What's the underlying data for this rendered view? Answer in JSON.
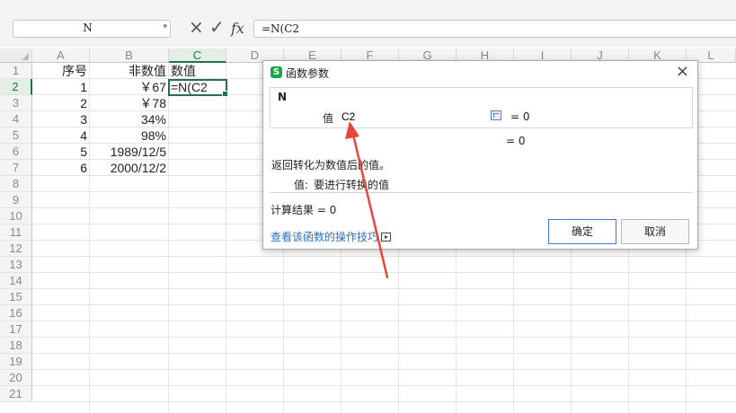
{
  "formula_bar": {
    "name_box_value": "N",
    "cancel_glyph": "×",
    "confirm_glyph": "✓",
    "fx_label": "fx",
    "formula": "=N(C2"
  },
  "grid": {
    "columns": [
      "A",
      "B",
      "C",
      "D",
      "E",
      "F",
      "G",
      "H",
      "I",
      "J",
      "K",
      "L"
    ],
    "selected_column": "C",
    "rows": [
      "1",
      "2",
      "3",
      "4",
      "5",
      "6",
      "7",
      "8",
      "9",
      "10",
      "11",
      "12",
      "13",
      "14",
      "15",
      "16",
      "17",
      "18",
      "19",
      "20",
      "21"
    ],
    "selected_row": "2",
    "headers": {
      "a": "序号",
      "b": "非数值",
      "c": "数值"
    },
    "data": [
      {
        "a": "1",
        "b": "￥67",
        "c": "=N(C2"
      },
      {
        "a": "2",
        "b": "￥78",
        "c": ""
      },
      {
        "a": "3",
        "b": "34%",
        "c": ""
      },
      {
        "a": "4",
        "b": "98%",
        "c": ""
      },
      {
        "a": "5",
        "b": "1989/12/5",
        "c": ""
      },
      {
        "a": "6",
        "b": "2000/12/2",
        "c": ""
      }
    ],
    "selection_color": "#217346"
  },
  "dialog": {
    "icon_glyph": "S",
    "title": "函数参数",
    "close_glyph": "×",
    "function_name": "N",
    "arg_label": "值",
    "arg_value": "C2",
    "arg_result": "= 0",
    "total_result": "= 0",
    "description": "返回转化为数值后的值。",
    "param_name": "值:",
    "param_desc": "要进行转换的值",
    "calc_result": "计算结果 = 0",
    "help_link": "查看该函数的操作技巧",
    "ok_label": "确定",
    "cancel_label": "取消",
    "link_color": "#2e6fc4",
    "accent_icon_color": "#1fa64b"
  },
  "annotation": {
    "arrow_color": "#e8453c"
  }
}
